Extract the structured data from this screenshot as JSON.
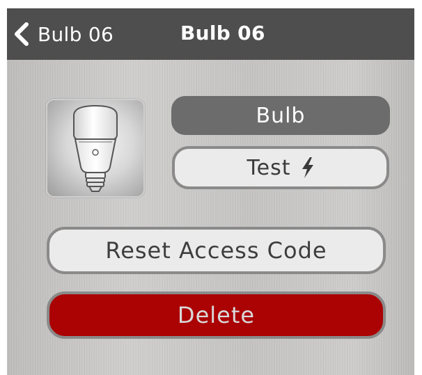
{
  "navbar": {
    "back_label": "Bulb 06",
    "title": "Bulb 06",
    "background_color": "#4e4e4e"
  },
  "device": {
    "icon": "light-bulb-icon",
    "name": "Bulb"
  },
  "actions": {
    "test_label": "Test",
    "test_icon": "lightning-bolt-icon",
    "reset_label": "Reset Access Code",
    "delete_label": "Delete"
  },
  "colors": {
    "delete": "#ab0203",
    "name_pill": "#6c6c6c",
    "button_fill": "#ebebeb",
    "button_border": "#8a8a8a"
  }
}
